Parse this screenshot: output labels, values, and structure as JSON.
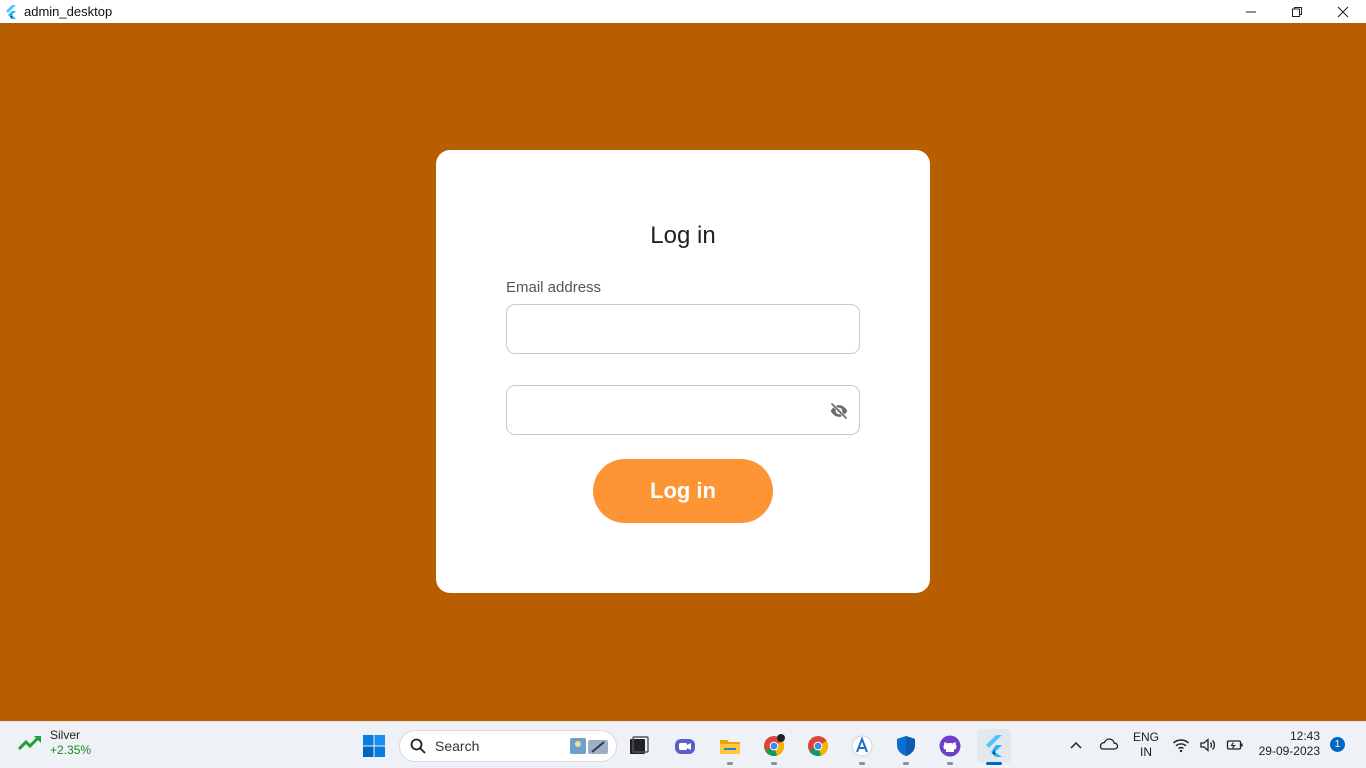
{
  "window": {
    "title": "admin_desktop",
    "controls": [
      "minimize",
      "restore",
      "close"
    ]
  },
  "colors": {
    "background": "#b75e00",
    "card": "#ffffff",
    "button": "#fd9535",
    "field_border": "#c9c9c9"
  },
  "login": {
    "heading": "Log in",
    "email_label": "Email address",
    "email_value": "",
    "password_value": "",
    "password_toggle_icon": "eye-off-icon",
    "button_label": "Log in"
  },
  "taskbar": {
    "widget": {
      "name": "Silver",
      "change": "+2.35%"
    },
    "search_placeholder": "Search",
    "apps": [
      "windows-start",
      "task-view",
      "teams-chat",
      "file-explorer",
      "chrome",
      "chrome-profile",
      "azure-data-studio",
      "windows-security",
      "github-desktop",
      "flutter"
    ],
    "language": {
      "line1": "ENG",
      "line2": "IN"
    },
    "clock": {
      "time": "12:43",
      "date": "29-09-2023"
    },
    "notification_count": "1"
  }
}
